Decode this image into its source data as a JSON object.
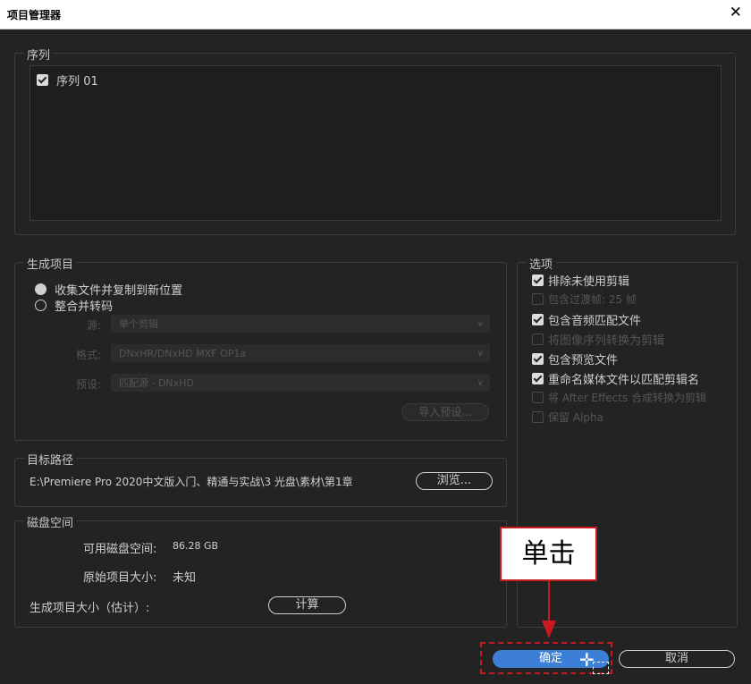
{
  "window": {
    "title": "项目管理器",
    "close_glyph": "✕"
  },
  "sequence_group": {
    "legend": "序列",
    "items": [
      {
        "label": "序列 01",
        "checked": true
      }
    ]
  },
  "generate_group": {
    "legend": "生成项目",
    "radio_collect": "收集文件并复制到新位置",
    "radio_consolidate": "整合并转码",
    "source_label": "源:",
    "source_value": "单个剪辑",
    "format_label": "格式:",
    "format_value": "DNxHR/DNxHD MXF OP1a",
    "preset_label": "预设:",
    "preset_value": "匹配源 - DNxHD",
    "import_preset": "导入预设..."
  },
  "options_group": {
    "legend": "选项",
    "items": [
      {
        "label": "排除未使用剪辑",
        "checked": true,
        "enabled": true
      },
      {
        "label": "包含过渡帧:  25 帧",
        "checked": false,
        "enabled": false
      },
      {
        "label": "包含音频匹配文件",
        "checked": true,
        "enabled": true
      },
      {
        "label": "将图像序列转换为剪辑",
        "checked": false,
        "enabled": false
      },
      {
        "label": "包含预览文件",
        "checked": true,
        "enabled": true
      },
      {
        "label": "重命名媒体文件以匹配剪辑名",
        "checked": true,
        "enabled": true
      },
      {
        "label": "将 After Effects 合成转换为剪辑",
        "checked": false,
        "enabled": false
      },
      {
        "label": "保留 Alpha",
        "checked": false,
        "enabled": false
      }
    ]
  },
  "destination_group": {
    "legend": "目标路径",
    "path": "E:\\Premiere Pro 2020中文版入门、精通与实战\\3 光盘\\素材\\第1章",
    "browse": "浏览..."
  },
  "disk_group": {
    "legend": "磁盘空间",
    "available_label": "可用磁盘空间:",
    "available_value": "86.28 GB",
    "original_label": "原始项目大小:",
    "original_value": "未知",
    "estimate_label": "生成项目大小（估计）:",
    "compute": "计算"
  },
  "buttons": {
    "ok": "确定",
    "cancel": "取消"
  },
  "annotation": {
    "callout_text": "单击",
    "color": "#c8191e"
  }
}
